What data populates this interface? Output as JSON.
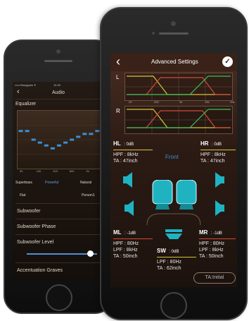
{
  "back_phone": {
    "status": {
      "carrier": "••••• Bouygues ✦",
      "time": "11:16"
    },
    "nav": {
      "title": "Audio",
      "back": "‹"
    },
    "equalizer": {
      "title": "Equalizer",
      "freq_labels": [
        "50",
        "100",
        "315",
        "800",
        "2k"
      ],
      "bands": [
        0.35,
        0.35,
        0.5,
        0.55,
        0.6,
        0.65,
        0.6,
        0.55,
        0.5,
        0.45,
        0.4,
        0.4,
        0.35
      ]
    },
    "presets_row1": [
      "Superbass",
      "Powerful",
      "Natural"
    ],
    "presets_row2": [
      "Flat",
      "Person1"
    ],
    "menu": [
      "Subwoofer",
      "Subwoofer Phase",
      "Subwoofer Level",
      "Accentuation Graves"
    ],
    "subwoofer_level": 0.9
  },
  "front_phone": {
    "nav": {
      "title": "Advanced Settings",
      "back": "‹",
      "confirm": "✓"
    },
    "crossover": {
      "left_label": "L",
      "right_label": "R",
      "freq_labels": [
        "20",
        "200",
        "2k",
        "10k",
        "20k"
      ]
    },
    "zone_label": "Front",
    "channels": {
      "hl": {
        "name": "HL",
        "gain": ": 0dB",
        "rows": [
          "HPF : 8kHz",
          "TA  : 47inch"
        ]
      },
      "hr": {
        "name": "HR",
        "gain": ": 0dB",
        "rows": [
          "HPF : 8kHz",
          "TA  : 47inch"
        ]
      },
      "ml": {
        "name": "ML",
        "gain": ": -1dB",
        "rows": [
          "HPF : 80Hz",
          "LPF : 8kHz",
          "TA  : 50inch"
        ]
      },
      "mr": {
        "name": "MR",
        "gain": ": -1dB",
        "rows": [
          "HPF : 80Hz",
          "LPF : 8kHz",
          "TA  : 50inch"
        ]
      },
      "sw": {
        "name": "SW",
        "gain": ": 0dB",
        "rows": [
          "LPF : 80Hz",
          "TA  : 62inch"
        ]
      }
    },
    "ta_button": "TA:Initial"
  },
  "colors": {
    "accent_blue": "#3b8ed6",
    "teal": "#1fb3c2",
    "yellow": "#d6c43a",
    "red": "#d04a3a",
    "green": "#3fbf5a"
  }
}
